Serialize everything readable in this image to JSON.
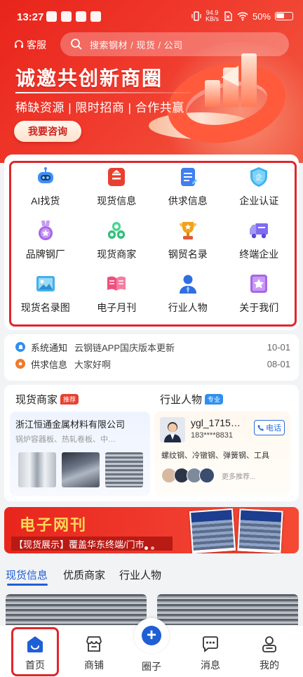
{
  "status_bar": {
    "time": "13:27",
    "net_speed_value": "94.9",
    "net_speed_unit": "KB/s",
    "battery": "50%"
  },
  "header": {
    "customer_service": "客服",
    "search_placeholder": "搜索钢材 / 现货 / 公司"
  },
  "hero": {
    "title": "诚邀共创新商圈",
    "subtitle": "稀缺资源 | 限时招商 | 合作共赢",
    "cta": "我要咨询"
  },
  "grid": [
    {
      "label": "AI找货",
      "icon": "ai-robot-icon",
      "color": "#3f8ef5"
    },
    {
      "label": "现货信息",
      "icon": "stock-info-icon",
      "color": "#e8402f"
    },
    {
      "label": "供求信息",
      "icon": "supply-demand-icon",
      "color": "#3f7ff0"
    },
    {
      "label": "企业认证",
      "icon": "enterprise-cert-icon",
      "color": "#3fb3f0"
    },
    {
      "label": "品牌钢厂",
      "icon": "brand-medal-icon",
      "color": "#a766e8"
    },
    {
      "label": "现货商家",
      "icon": "merchant-coins-icon",
      "color": "#2fbf7a"
    },
    {
      "label": "钢贸名录",
      "icon": "trophy-icon",
      "color": "#f0a21c"
    },
    {
      "label": "终端企业",
      "icon": "truck-icon",
      "color": "#7f6cf0"
    },
    {
      "label": "现货名录图",
      "icon": "image-icon",
      "color": "#43b0e8"
    },
    {
      "label": "电子月刊",
      "icon": "book-icon",
      "color": "#ef4f7c"
    },
    {
      "label": "行业人物",
      "icon": "person-icon",
      "color": "#2f6fe0"
    },
    {
      "label": "关于我们",
      "icon": "star-badge-icon",
      "color": "#a766e8"
    }
  ],
  "notices": [
    {
      "type": "系统通知",
      "text": "云钢链APP国庆版本更新",
      "date": "10-01",
      "color": "#2f8ff0"
    },
    {
      "type": "供求信息",
      "text": "大家好啊",
      "date": "08-01",
      "color": "#f07a2a"
    }
  ],
  "merchants_section": {
    "title": "现货商家",
    "badge": "推荐",
    "company": "浙江恒通金属材料有限公司",
    "products": "锅炉容器板、热轧卷板、中…"
  },
  "people_section": {
    "title": "行业人物",
    "badge": "专业",
    "name": "ygl_1715…",
    "phone": "183****8831",
    "call_label": "电话",
    "tags": "螺纹钢、冷镦钢、弹簧钢、工具",
    "more": "更多推荐..."
  },
  "banner": {
    "title": "电子网刊",
    "subtitle": "【现货展示】覆盖华东终端/门市"
  },
  "tabs": [
    {
      "label": "现货信息",
      "active": true
    },
    {
      "label": "优质商家",
      "active": false
    },
    {
      "label": "行业人物",
      "active": false
    }
  ],
  "bottom_nav": [
    {
      "label": "首页",
      "icon": "home-icon",
      "active": true
    },
    {
      "label": "商铺",
      "icon": "shop-icon",
      "active": false
    },
    {
      "label": "圈子",
      "icon": "plus-icon",
      "active": false
    },
    {
      "label": "消息",
      "icon": "message-icon",
      "active": false
    },
    {
      "label": "我的",
      "icon": "profile-icon",
      "active": false
    }
  ],
  "colors": {
    "brand_red": "#e8241b",
    "accent_blue": "#1f5fd6",
    "highlight_outline": "#e0262b"
  }
}
